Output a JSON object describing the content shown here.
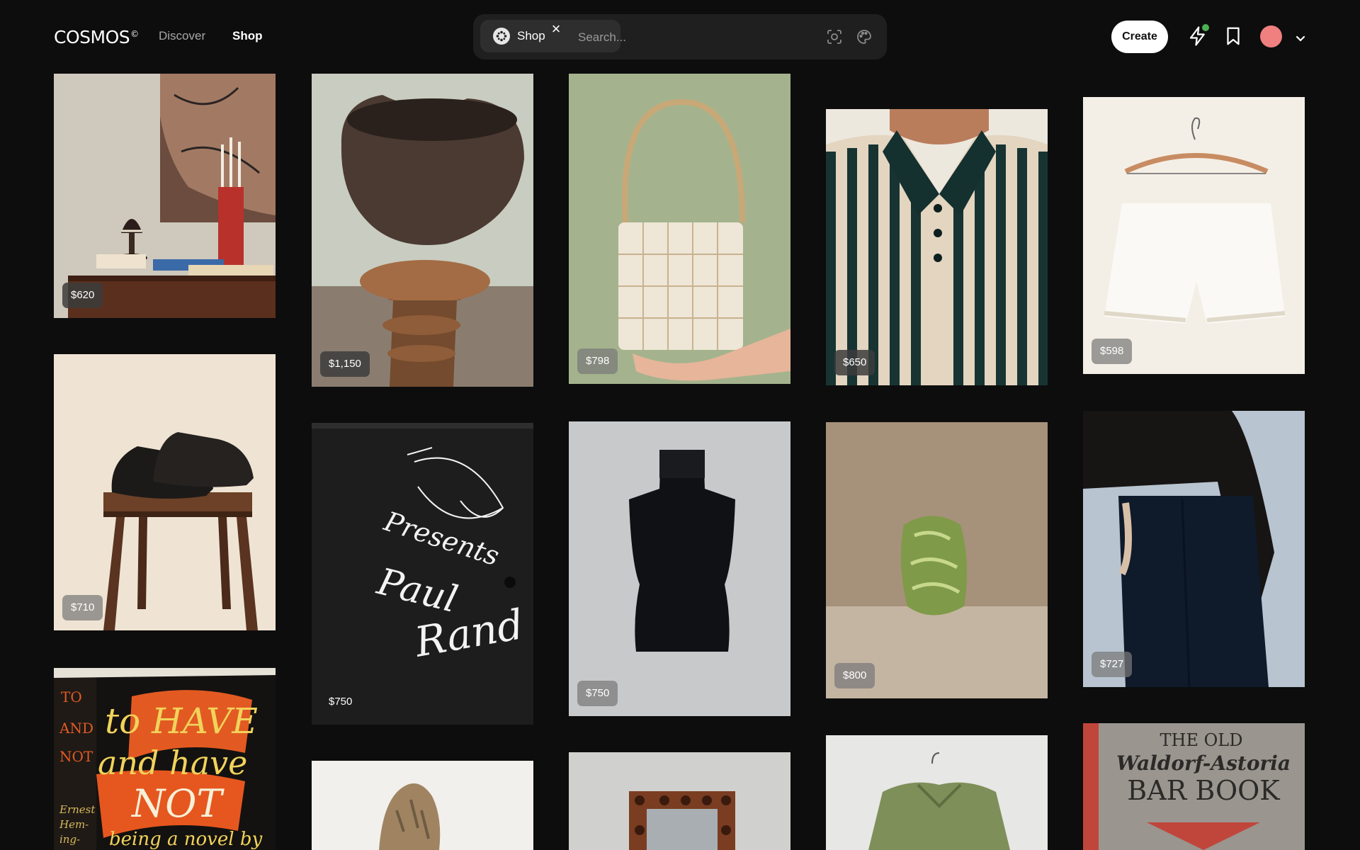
{
  "header": {
    "logo": "COSMOS",
    "logo_mark": "©",
    "nav": {
      "discover": "Discover",
      "shop": "Shop"
    },
    "search": {
      "chip_label": "Shop",
      "chip_close": "×",
      "placeholder": "Search..."
    },
    "create_label": "Create",
    "colors": {
      "avatar": "#f07f7f",
      "notification_dot": "#4caf50"
    }
  },
  "products": [
    {
      "id": "lamp-sideboard",
      "price": "$620"
    },
    {
      "id": "stone-vessel",
      "price": "$1,150"
    },
    {
      "id": "shell-handbag",
      "price": "$798"
    },
    {
      "id": "striped-polo",
      "price": "$650"
    },
    {
      "id": "white-shorts",
      "price": "$598"
    },
    {
      "id": "black-loafers",
      "price": "$710"
    },
    {
      "id": "paul-rand-book",
      "price": "$750"
    },
    {
      "id": "knit-turtleneck",
      "price": "$750"
    },
    {
      "id": "green-glass-vase",
      "price": "$800"
    },
    {
      "id": "black-trousers",
      "price": "$727"
    },
    {
      "id": "hemingway-book",
      "price": ""
    },
    {
      "id": "stone-sculpture",
      "price": ""
    },
    {
      "id": "wood-mirror",
      "price": ""
    },
    {
      "id": "olive-jacket",
      "price": ""
    },
    {
      "id": "bar-book",
      "price": ""
    }
  ],
  "book_texts": {
    "paul_rand": [
      "Presents",
      "Paul",
      "Rand"
    ],
    "hemingway": [
      "to HAVE",
      "and have",
      "NOT",
      "being a novel by",
      "TO",
      "AND",
      "NOT",
      "Ernest",
      "Hem-",
      "ing-"
    ],
    "bar_book": [
      "THE OLD",
      "Waldorf-Astoria",
      "BAR BOOK"
    ]
  }
}
